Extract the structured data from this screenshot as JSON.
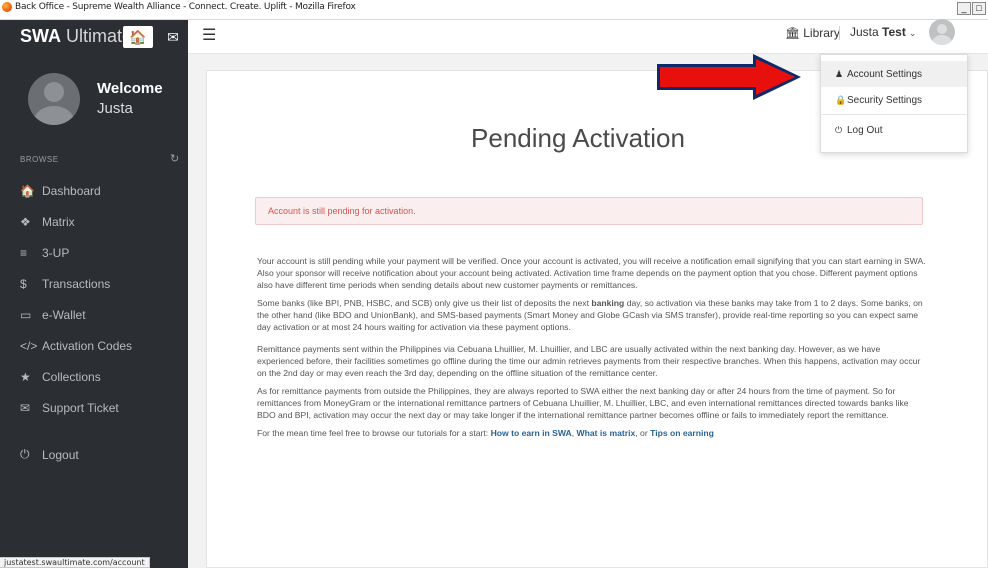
{
  "browser": {
    "title": "Back Office - Supreme Wealth Alliance - Connect. Create. Uplift - Mozilla Firefox",
    "status_url": "justatest.swaultimate.com/account"
  },
  "sidebar": {
    "brand_bold": "SWA",
    "brand_light": " Ultimate",
    "welcome": "Welcome",
    "username": "Justa",
    "browse_label": "BROWSE",
    "items": [
      {
        "label": "Dashboard",
        "icon": "🏠"
      },
      {
        "label": "Matrix",
        "icon": "❖"
      },
      {
        "label": "3-UP",
        "icon": "≡"
      },
      {
        "label": "Transactions",
        "icon": "$"
      },
      {
        "label": "e-Wallet",
        "icon": "▭"
      },
      {
        "label": "Activation Codes",
        "icon": "</>"
      },
      {
        "label": "Collections",
        "icon": "★"
      },
      {
        "label": "Support Ticket",
        "icon": "✉"
      },
      {
        "label": "Logout",
        "icon": "⏻"
      }
    ]
  },
  "topbar": {
    "library": "Library",
    "user_first": "Justa",
    "user_last": "Test"
  },
  "dropdown": {
    "items": [
      {
        "label": "Account Settings",
        "icon": "♟"
      },
      {
        "label": "Security Settings",
        "icon": "🔒"
      },
      {
        "label": "Log Out",
        "icon": "⏻"
      }
    ]
  },
  "main": {
    "title": "Pending Activation",
    "alert": "Account is still pending for activation.",
    "paragraphs": [
      "Your account is still pending while your payment will be verified. Once your account is activated, you will receive a notification email signifying that you can start earning in SWA. Also your sponsor will receive notification about your account being activated. Activation time frame depends on the payment option that you chose. Different payment options also have different time periods when sending details about new customer payments or remittances.",
      "Remittance payments sent within the Philippines via Cebuana Lhuillier, M. Lhuillier, and LBC are usually activated within the next banking day. However, as we have experienced before, their facilities sometimes go offline during the time our admin retrieves payments from their respective branches. When this happens, activation may occur on the 2nd day or may even reach the 3rd day, depending on the offline situation of the remittance center.",
      "As for remittance payments from outside the Philippines, they are always reported to SWA either the next banking day or after 24 hours from the time of payment. So for remittances from MoneyGram or the international remittance partners of Cebuana Lhuillier, M. Lhuillier, LBC, and even international remittances directed towards banks like BDO and BPI, activation may occur the next day or may take longer if the international remittance partner becomes offline or fails to immediately report the remittance."
    ],
    "banks_pre": "Some banks (like BPI, PNB, HSBC, and SCB) only give us their list of deposits the next ",
    "banks_bold": "banking",
    "banks_post": " day, so activation via these banks may take from 1 to 2 days. Some banks, on the other hand (like BDO and UnionBank), and SMS-based payments (Smart Money and Globe GCash via SMS transfer), provide real-time reporting so you can expect same day activation or at most 24 hours waiting for activation via these payment options.",
    "tutorial_intro": "For the mean time feel free to browse our tutorials for a start: ",
    "links": [
      "How to earn in SWA",
      "What is matrix",
      "Tips on earning"
    ],
    "sep1": ", ",
    "sep2": ", or "
  },
  "colors": {
    "sidebar_bg": "#2b2e33",
    "alert_text": "#d9534f",
    "arrow": "#e8100c",
    "link": "#2a6496"
  }
}
